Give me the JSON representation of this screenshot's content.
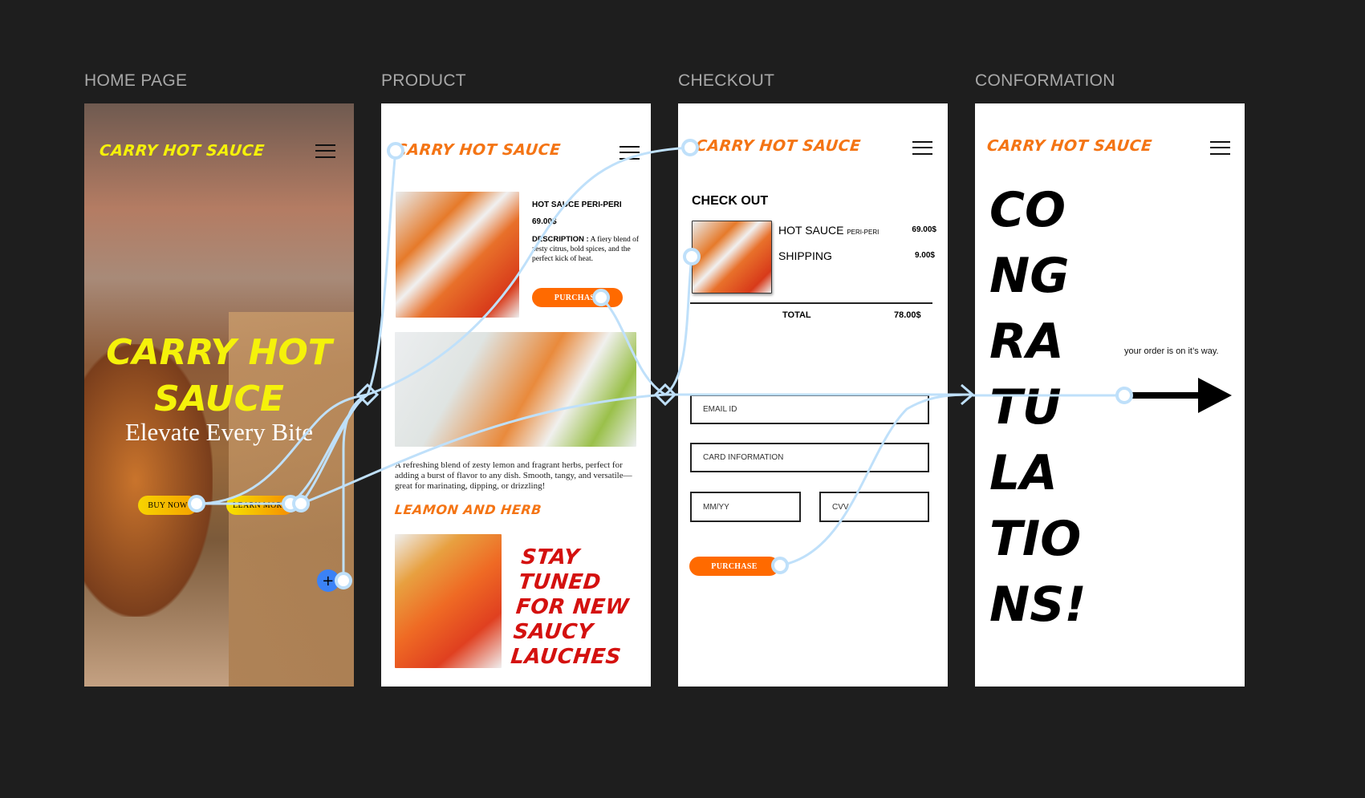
{
  "frames": {
    "home": {
      "label": "HOME PAGE",
      "logo": "CARRY HOT SAUCE",
      "hero_title_1": "CARRY HOT",
      "hero_title_2": "SAUCE",
      "tagline": "Elevate Every Bite",
      "buy_now": "BUY NOW",
      "learn_more": "LEARN MORE",
      "add_button": "+"
    },
    "product": {
      "label": "PRODUCT",
      "logo": "CARRY HOT SAUCE",
      "product_name": "HOT SAUCE PERI-PERI",
      "price": "69.00$",
      "description_label": "DESCRIPTION :",
      "description": "A fiery blend of zesty citrus, bold spices, and the perfect kick of heat.",
      "purchase": "PURCHASE",
      "paragraph": "A refreshing blend of zesty lemon and fragrant herbs, perfect for adding a burst of flavor to any dish. Smooth, tangy, and versatile—great for marinating, dipping, or drizzling!",
      "flavor_title": "LEAMON AND HERB",
      "promo": "STAY TUNED FOR NEW SAUCY LAUCHES"
    },
    "checkout": {
      "label": "CHECKOUT",
      "logo": "CARRY HOT SAUCE",
      "title": "CHECK OUT",
      "item_name": "HOT SAUCE",
      "item_variant": "PERI-PERI",
      "item_price": "69.00$",
      "shipping_label": "SHIPPING",
      "shipping_price": "9.00$",
      "total_label": "TOTAL",
      "total_price": "78.00$",
      "email_placeholder": "EMAIL ID",
      "card_placeholder": "CARD INFORMATION",
      "expiry_placeholder": "MM/YY",
      "cvv_placeholder": "CVV",
      "purchase": "PURCHASE"
    },
    "confirmation": {
      "label": "CONFORMATION",
      "logo": "CARRY HOT SAUCE",
      "congrats_lines": [
        "CO",
        "NG",
        "RA",
        "TU",
        "LA",
        "TIO",
        "NS!"
      ],
      "message": "your order is on it’s way."
    }
  },
  "colors": {
    "background": "#1e1e1e",
    "logo_yellow": "#f5f20a",
    "logo_orange": "#f47414",
    "button_orange": "#ff6a00",
    "promo_red": "#d4110f",
    "connector": "#bfe0fa",
    "add_button": "#3b82f6"
  }
}
